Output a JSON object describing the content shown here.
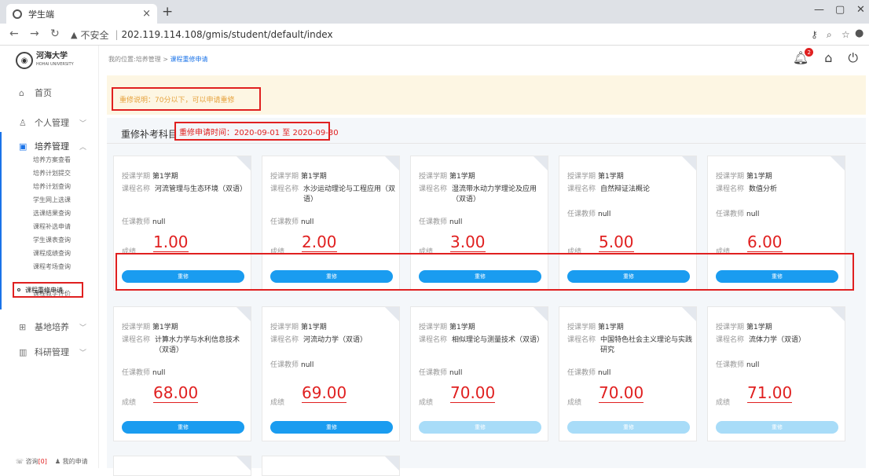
{
  "browser": {
    "tab_title": "学生端",
    "close": "×",
    "new_tab": "+",
    "insecure": "不安全",
    "url": "202.119.114.108/gmis/student/default/index"
  },
  "logo": {
    "name": "河海大学",
    "sub": "HOHAI UNIVERSITY"
  },
  "sidebar": {
    "menus": [
      {
        "label": "首页",
        "icon": "home-icon"
      },
      {
        "label": "个人管理",
        "icon": "user-icon"
      },
      {
        "label": "培养管理",
        "icon": "book-icon"
      },
      {
        "label": "基地培养",
        "icon": "grid-icon"
      },
      {
        "label": "科研管理",
        "icon": "chart-icon"
      }
    ],
    "sub_items": [
      "培养方案查看",
      "培养计划提交",
      "培养计划查询",
      "学生网上选课",
      "选课结果查询",
      "课程补选申请",
      "学生课表查询",
      "课程成绩查询",
      "课程考场查询",
      "课程重修申请",
      "课程教学评价"
    ],
    "footer": {
      "consult": "咨询",
      "consult_count": "[0]",
      "my_apply": "我的申请"
    }
  },
  "breadcrumb": {
    "prefix": "我的位置:培养管理 > ",
    "current": "课程重修申请"
  },
  "header": {
    "bell_badge": "2"
  },
  "notice": "重修说明：70分以下，可以申请重修",
  "section": {
    "title": "重修补考科目",
    "time": "重修申请时间：2020-09-01  至 2020-09-30"
  },
  "labels": {
    "term": "授课学期",
    "course": "课程名称",
    "teacher": "任课教师",
    "score": "成绩",
    "button": "重修"
  },
  "cards": [
    {
      "term": "第1学期",
      "course": "河流管理与生态环境（双语）",
      "teacher": "null",
      "score": "1.00",
      "enabled": true
    },
    {
      "term": "第1学期",
      "course": "水沙运动理论与工程应用（双语）",
      "teacher": "null",
      "score": "2.00",
      "enabled": true
    },
    {
      "term": "第1学期",
      "course": "湿流带水动力学理论及应用（双语）",
      "teacher": "null",
      "score": "3.00",
      "enabled": true
    },
    {
      "term": "第1学期",
      "course": "自然辩证法概论",
      "teacher": "null",
      "score": "5.00",
      "enabled": true
    },
    {
      "term": "第1学期",
      "course": "数值分析",
      "teacher": "null",
      "score": "6.00",
      "enabled": true
    },
    {
      "term": "第1学期",
      "course": "计算水力学与水利信息技术（双语）",
      "teacher": "null",
      "score": "68.00",
      "enabled": true
    },
    {
      "term": "第1学期",
      "course": "河流动力学（双语）",
      "teacher": "null",
      "score": "69.00",
      "enabled": true
    },
    {
      "term": "第1学期",
      "course": "相似理论与测量技术（双语）",
      "teacher": "null",
      "score": "70.00",
      "enabled": false
    },
    {
      "term": "第1学期",
      "course": "中国特色社会主义理论与实践研究",
      "teacher": "null",
      "score": "70.00",
      "enabled": false
    },
    {
      "term": "第1学期",
      "course": "流体力学（双语）",
      "teacher": "null",
      "score": "71.00",
      "enabled": false
    }
  ]
}
